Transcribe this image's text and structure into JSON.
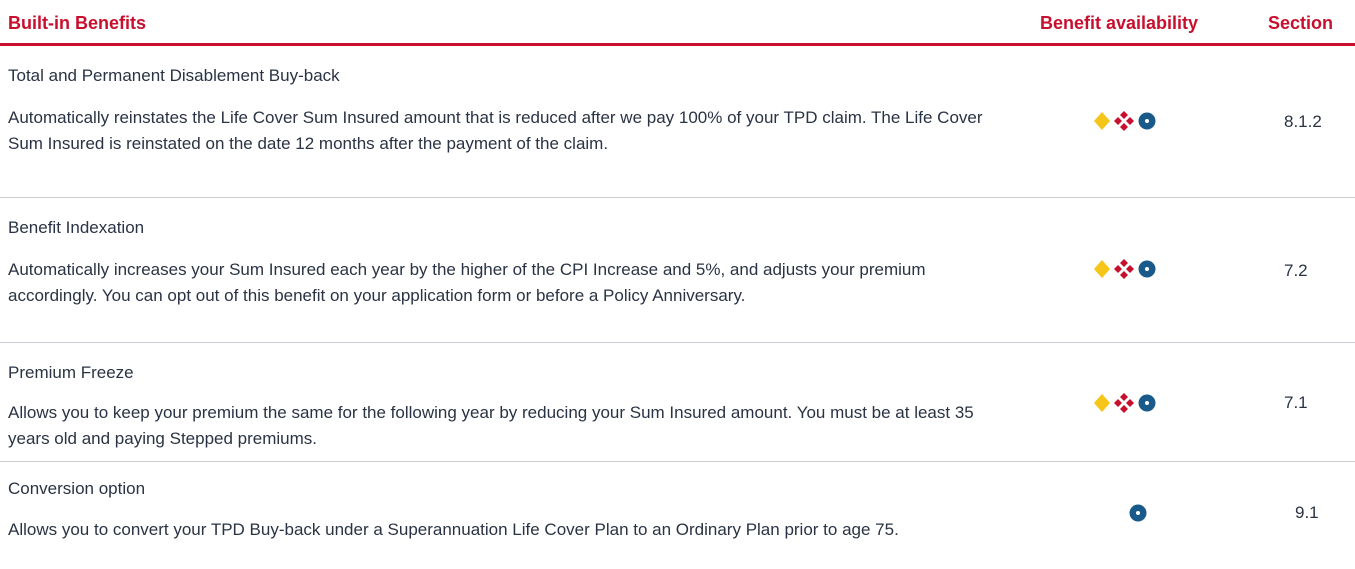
{
  "header": {
    "benefits": "Built-in Benefits",
    "availability": "Benefit availability",
    "section": "Section"
  },
  "colors": {
    "accent_red": "#c8102e",
    "text": "#2a3343",
    "diamond_gold": "#f5c518",
    "cluster_red": "#c8102e",
    "dot_blue": "#1a5a8a"
  },
  "icons": {
    "diamond": "yellow-diamond-icon",
    "cluster": "red-four-diamond-cluster-icon",
    "dot": "blue-circle-dot-icon"
  },
  "rows": [
    {
      "title": "Total and Permanent Disablement Buy-back",
      "description": "Automatically reinstates the Life Cover Sum Insured amount that is reduced after we pay 100% of your TPD claim. The Life Cover Sum Insured is reinstated on the date 12 months after the payment of the claim.",
      "availability": [
        "diamond",
        "cluster",
        "dot"
      ],
      "section": "8.1.2"
    },
    {
      "title": "Benefit Indexation",
      "description": "Automatically increases your Sum Insured each year by the higher of the CPI Increase and 5%, and adjusts your premium accordingly. You can opt out of this benefit on your application form or before a Policy Anniversary.",
      "availability": [
        "diamond",
        "cluster",
        "dot"
      ],
      "section": "7.2"
    },
    {
      "title": "Premium Freeze",
      "description": "Allows you to keep your premium the same for the following year by reducing your Sum Insured amount. You must be at least 35 years old and paying Stepped premiums.",
      "availability": [
        "diamond",
        "cluster",
        "dot"
      ],
      "section": "7.1"
    },
    {
      "title": "Conversion option",
      "description": "Allows you to convert your TPD Buy-back under a Superannuation Life Cover Plan to an Ordinary Plan prior to age 75.",
      "availability": [
        "dot"
      ],
      "section": "9.1"
    }
  ]
}
